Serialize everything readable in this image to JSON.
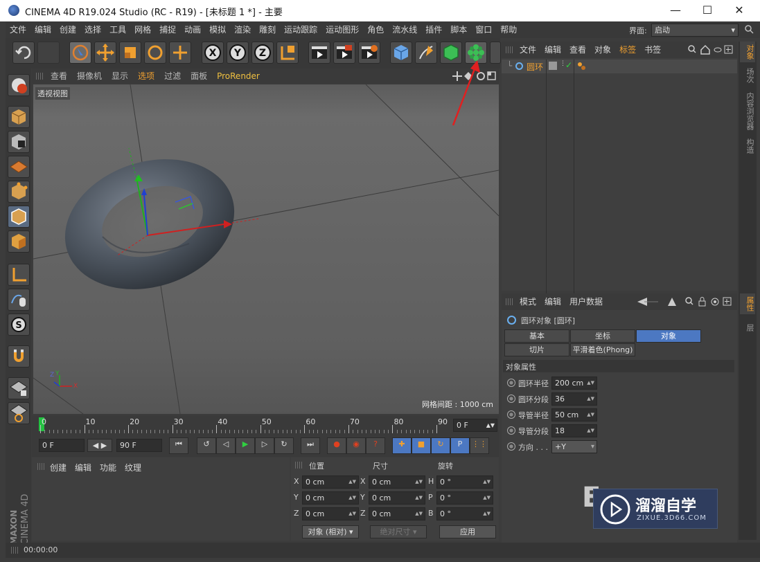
{
  "window": {
    "title": "CINEMA 4D R19.024 Studio (RC - R19) - [未标题 1 *] - 主要"
  },
  "menubar": {
    "items": [
      "文件",
      "编辑",
      "创建",
      "选择",
      "工具",
      "网格",
      "捕捉",
      "动画",
      "模拟",
      "渲染",
      "雕刻",
      "运动跟踪",
      "运动图形",
      "角色",
      "流水线",
      "插件",
      "脚本",
      "窗口",
      "帮助"
    ],
    "layout_label": "界面:",
    "layout_value": "启动"
  },
  "viewport": {
    "menu": [
      "查看",
      "摄像机",
      "显示",
      "选项",
      "过滤",
      "面板",
      "ProRender"
    ],
    "view_name": "透视视图",
    "grid_label": "网格间距 : 1000 cm",
    "axis_labels": {
      "z": "Z",
      "y": "Y",
      "x": "X"
    }
  },
  "timeline": {
    "ticks": [
      "0",
      "10",
      "20",
      "30",
      "40",
      "50",
      "60",
      "70",
      "80",
      "90"
    ],
    "current_frame": "0 F"
  },
  "playback": {
    "start": "0 F",
    "end": "90 F"
  },
  "material_manager": {
    "menu": [
      "创建",
      "编辑",
      "功能",
      "纹理"
    ]
  },
  "coord_manager": {
    "headers": [
      "位置",
      "尺寸",
      "旋转"
    ],
    "rows": [
      {
        "a": "X",
        "av": "0 cm",
        "b": "X",
        "bv": "0 cm",
        "c": "H",
        "cv": "0 °"
      },
      {
        "a": "Y",
        "av": "0 cm",
        "b": "Y",
        "bv": "0 cm",
        "c": "P",
        "cv": "0 °"
      },
      {
        "a": "Z",
        "av": "0 cm",
        "b": "Z",
        "bv": "0 cm",
        "c": "B",
        "cv": "0 °"
      }
    ],
    "mode": "对象 (相对)",
    "size_mode": "绝对尺寸",
    "apply": "应用"
  },
  "status": {
    "time": "00:00:00"
  },
  "object_manager": {
    "menu": [
      "文件",
      "编辑",
      "查看",
      "对象",
      "标签",
      "书签"
    ],
    "objects": [
      {
        "name": "圆环"
      }
    ]
  },
  "attribute_manager": {
    "menu": [
      "模式",
      "编辑",
      "用户数据"
    ],
    "title": "圆环对象 [圆环]",
    "tabs_row1": [
      "基本",
      "坐标",
      "对象"
    ],
    "tabs_row2": [
      "切片",
      "平滑着色(Phong)"
    ],
    "section": "对象属性",
    "params": [
      {
        "label": "圆环半径",
        "value": "200 cm"
      },
      {
        "label": "圆环分段",
        "value": "36"
      },
      {
        "label": "导管半径",
        "value": "50 cm"
      },
      {
        "label": "导管分段",
        "value": "18"
      },
      {
        "label": "方向 . . .",
        "value": "+Y"
      }
    ]
  },
  "right_tabs": [
    "对象",
    "场次",
    "内容浏览器",
    "构造"
  ],
  "right_tabs2": [
    "属性",
    "层"
  ],
  "brand": {
    "maxon": "MAXON",
    "cinema": "CINEMA 4D"
  },
  "watermark": {
    "cn": "溜溜自学",
    "url": "ZIXUE.3D66.COM"
  },
  "colors": {
    "accent": "#f0a030",
    "active_tab": "#4c78c2",
    "torus": "#4a525c"
  }
}
